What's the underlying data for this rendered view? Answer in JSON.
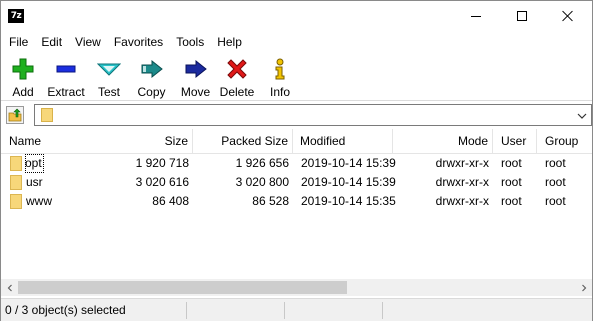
{
  "window": {
    "app_icon_text": "7z"
  },
  "menu": [
    "File",
    "Edit",
    "View",
    "Favorites",
    "Tools",
    "Help"
  ],
  "toolbar": {
    "add": "Add",
    "extract": "Extract",
    "test": "Test",
    "copy": "Copy",
    "move": "Move",
    "delete": "Delete",
    "info": "Info"
  },
  "address": {
    "value": ""
  },
  "columns": {
    "name": "Name",
    "size": "Size",
    "packed": "Packed Size",
    "modified": "Modified",
    "mode": "Mode",
    "user": "User",
    "group": "Group"
  },
  "rows": [
    {
      "name": "opt",
      "size": "1 920 718",
      "packed": "1 926 656",
      "modified": "2019-10-14 15:39",
      "mode": "drwxr-xr-x",
      "user": "root",
      "group": "root"
    },
    {
      "name": "usr",
      "size": "3 020 616",
      "packed": "3 020 800",
      "modified": "2019-10-14 15:39",
      "mode": "drwxr-xr-x",
      "user": "root",
      "group": "root"
    },
    {
      "name": "www",
      "size": "86 408",
      "packed": "86 528",
      "modified": "2019-10-14 15:35",
      "mode": "drwxr-xr-x",
      "user": "root",
      "group": "root"
    }
  ],
  "status": {
    "selection": "0 / 3 object(s) selected"
  },
  "colors": {
    "add_green": "#1fb01f",
    "extract_blue": "#1b2ee0",
    "test_cyan": "#29c3c9",
    "copy_teal": "#1c8a8a",
    "move_navy": "#1b2a9e",
    "delete_red": "#e01818",
    "info_yellow": "#f2c400",
    "folder_yellow": "#f7d77a"
  }
}
